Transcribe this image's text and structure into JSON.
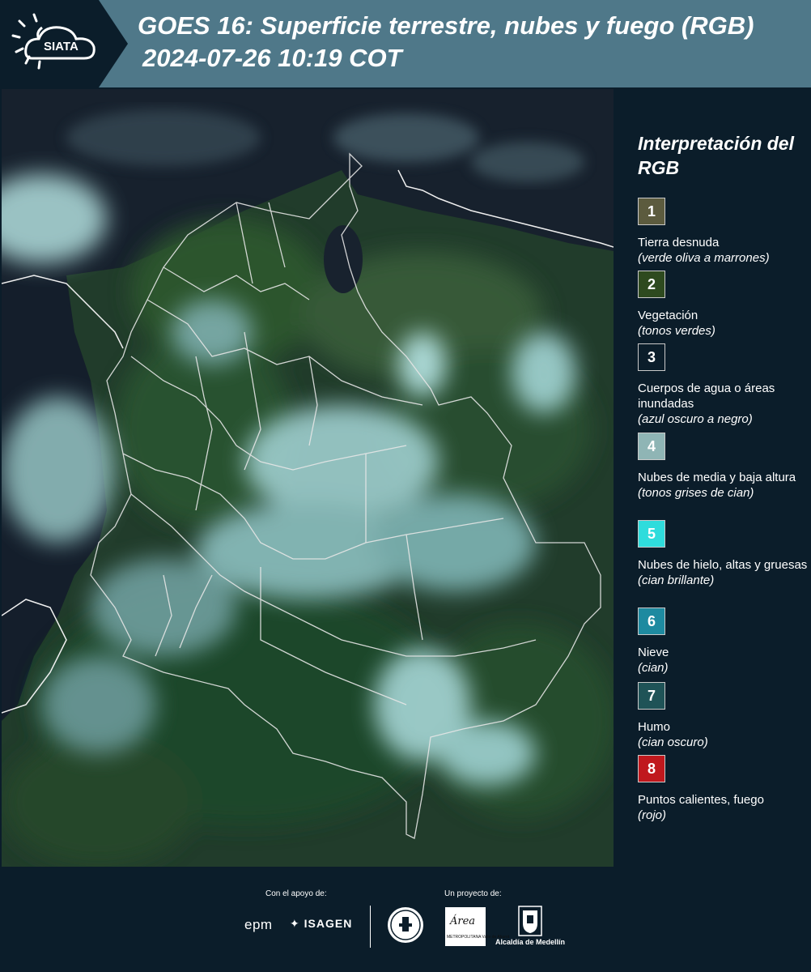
{
  "header": {
    "logo_text": "SIATA",
    "title": "GOES 16: Superficie terrestre, nubes y fuego (RGB)",
    "subtitle": "2024-07-26 10:19 COT",
    "background_color": "#4f7889"
  },
  "map": {
    "name": "satellite-rgb-image-colombia"
  },
  "legend": {
    "title": "Interpretación del RGB",
    "items": [
      {
        "number": "1",
        "label": "Tierra desnuda",
        "desc": "(verde oliva a marrones)",
        "color": "#5c5b3e"
      },
      {
        "number": "2",
        "label": "Vegetación",
        "desc": "(tonos verdes)",
        "color": "#2e4a1f"
      },
      {
        "number": "3",
        "label": "Cuerpos de agua o áreas inundadas",
        "desc": "(azul oscuro a negro)",
        "color": "#0b1d2a"
      },
      {
        "number": "4",
        "label": "Nubes de media y baja altura",
        "desc": "(tonos grises de cian)",
        "color": "#8fb5b5"
      },
      {
        "number": "5",
        "label": "Nubes de hielo, altas y gruesas",
        "desc": "(cian brillante)",
        "color": "#2fdcdc"
      },
      {
        "number": "6",
        "label": "Nieve",
        "desc": "(cian)",
        "color": "#1e8aa0"
      },
      {
        "number": "7",
        "label": "Humo",
        "desc": "(cian oscuro)",
        "color": "#1f5357"
      },
      {
        "number": "8",
        "label": "Puntos calientes, fuego",
        "desc": "(rojo)",
        "color": "#c0181d"
      }
    ]
  },
  "footer": {
    "support_label": "Con el apoyo de:",
    "project_label": "Un proyecto de:",
    "sponsor_1": "epm",
    "sponsor_2": "ISAGEN",
    "area_logo_text": "Área",
    "area_logo_sub": "METROPOLITANA Valle de Aburrá",
    "medellin_label": "Alcaldía de Medellín"
  }
}
